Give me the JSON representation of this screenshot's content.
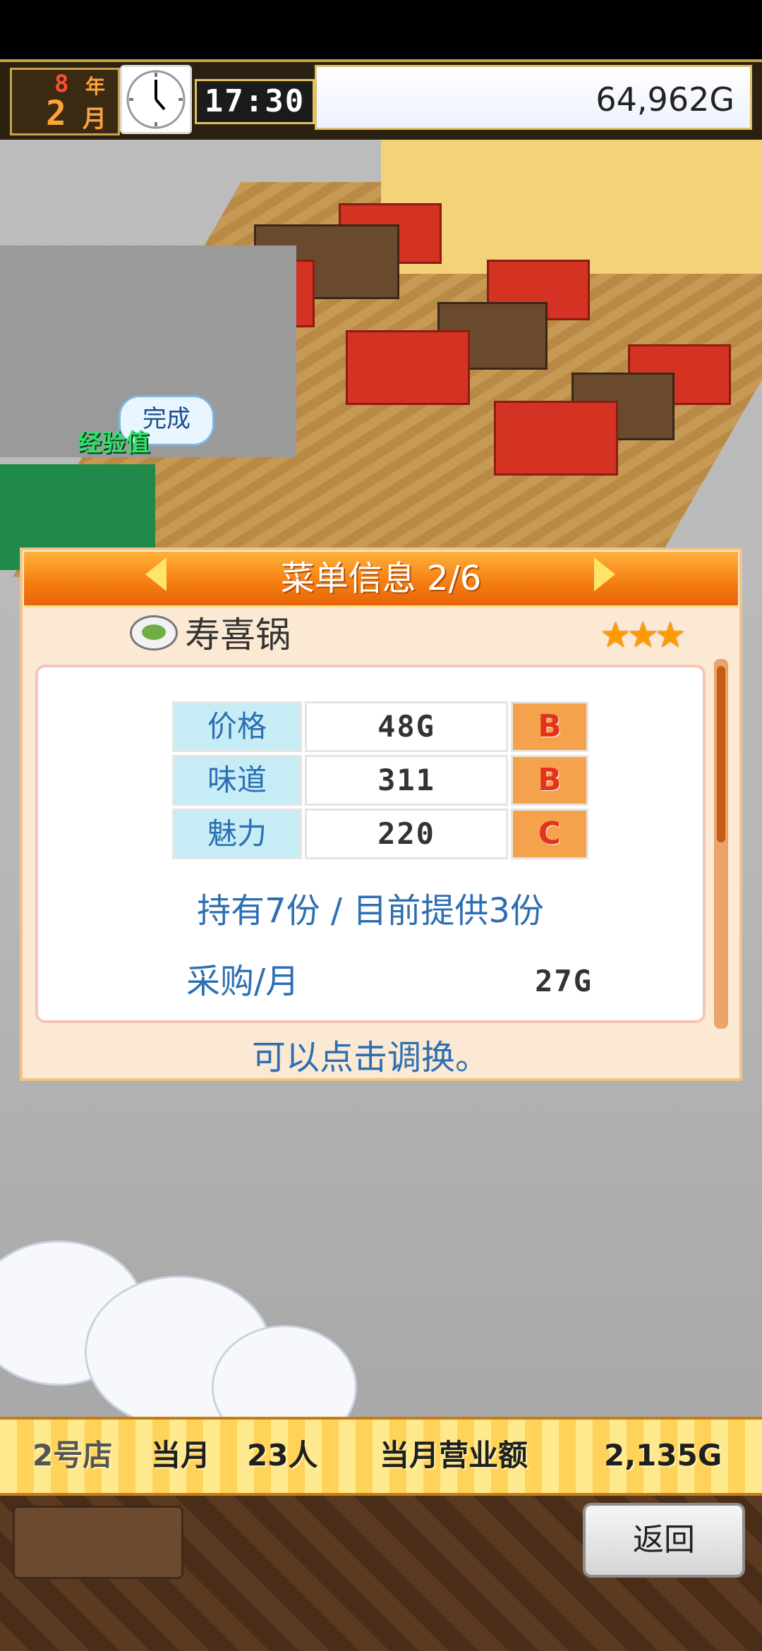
{
  "status": {
    "year_number": "8",
    "year_label": "年",
    "month_number": "2",
    "month_label": "月",
    "time": "17:30",
    "money": "64,962G"
  },
  "world": {
    "complete_bubble": "完成",
    "exp_label": "经验值"
  },
  "panel": {
    "title": "菜单信息 2/6",
    "dish_name": "寿喜锅",
    "stars": "★★★",
    "stats": [
      {
        "label": "价格",
        "value": "48G",
        "grade": "B"
      },
      {
        "label": "味道",
        "value": "311",
        "grade": "B"
      },
      {
        "label": "魅力",
        "value": "220",
        "grade": "C"
      }
    ],
    "stock_line": "持有7份 / 目前提供3份",
    "purchase_label": "采购/月",
    "purchase_value": "27G",
    "hint": "可以点击调换。"
  },
  "infobar": {
    "store": "2号店",
    "this_month": "当月",
    "visitors": "23人",
    "monthly_sales_label": "当月营业额",
    "monthly_sales_value": "2,135G"
  },
  "controls": {
    "back_label": "返回"
  },
  "colors": {
    "header_orange": "#f47c10",
    "label_blue": "#2d6fb3",
    "grade_orange": "#f4a24c",
    "grade_red": "#e3331d"
  }
}
